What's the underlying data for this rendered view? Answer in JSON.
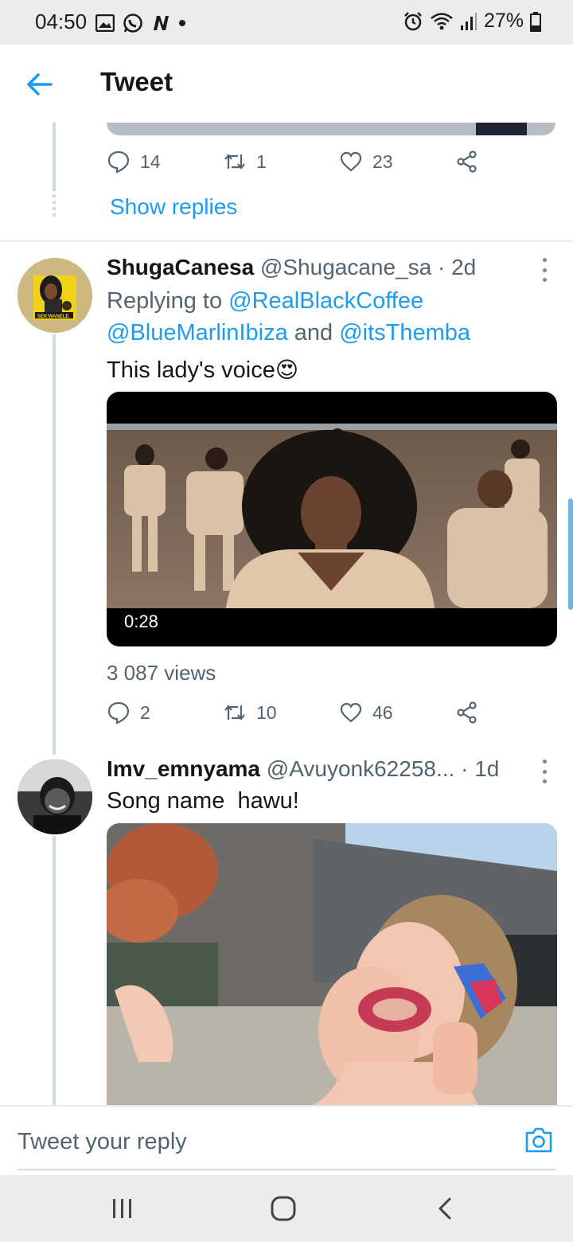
{
  "status_bar": {
    "time": "04:50",
    "battery": "27%"
  },
  "header": {
    "title": "Tweet"
  },
  "prev_tweet": {
    "reply_count": "14",
    "retweet_count": "1",
    "like_count": "23",
    "show_replies": "Show replies"
  },
  "tweet1": {
    "name": "ShugaCanesa",
    "handle": "@Shugacane_sa",
    "age": "· 2d",
    "replying_prefix": "Replying to",
    "mention1": "@RealBlackCoffee",
    "mention2": "@BlueMarlinIbiza",
    "and": "and",
    "mention3": "@itsThemba",
    "text": "This lady's voice",
    "emoji": "😍",
    "video_duration": "0:28",
    "views": "3 087 views",
    "reply_count": "2",
    "retweet_count": "10",
    "like_count": "46"
  },
  "tweet2": {
    "name": "Imv_emnyama",
    "handle": "@Avuyonk62258...",
    "age": "· 1d",
    "text": "Song name  hawu!"
  },
  "reply_bar": {
    "placeholder": "Tweet your reply"
  },
  "colors": {
    "accent": "#1d9bf0",
    "secondary_text": "#536471",
    "primary_text": "#14171a"
  }
}
